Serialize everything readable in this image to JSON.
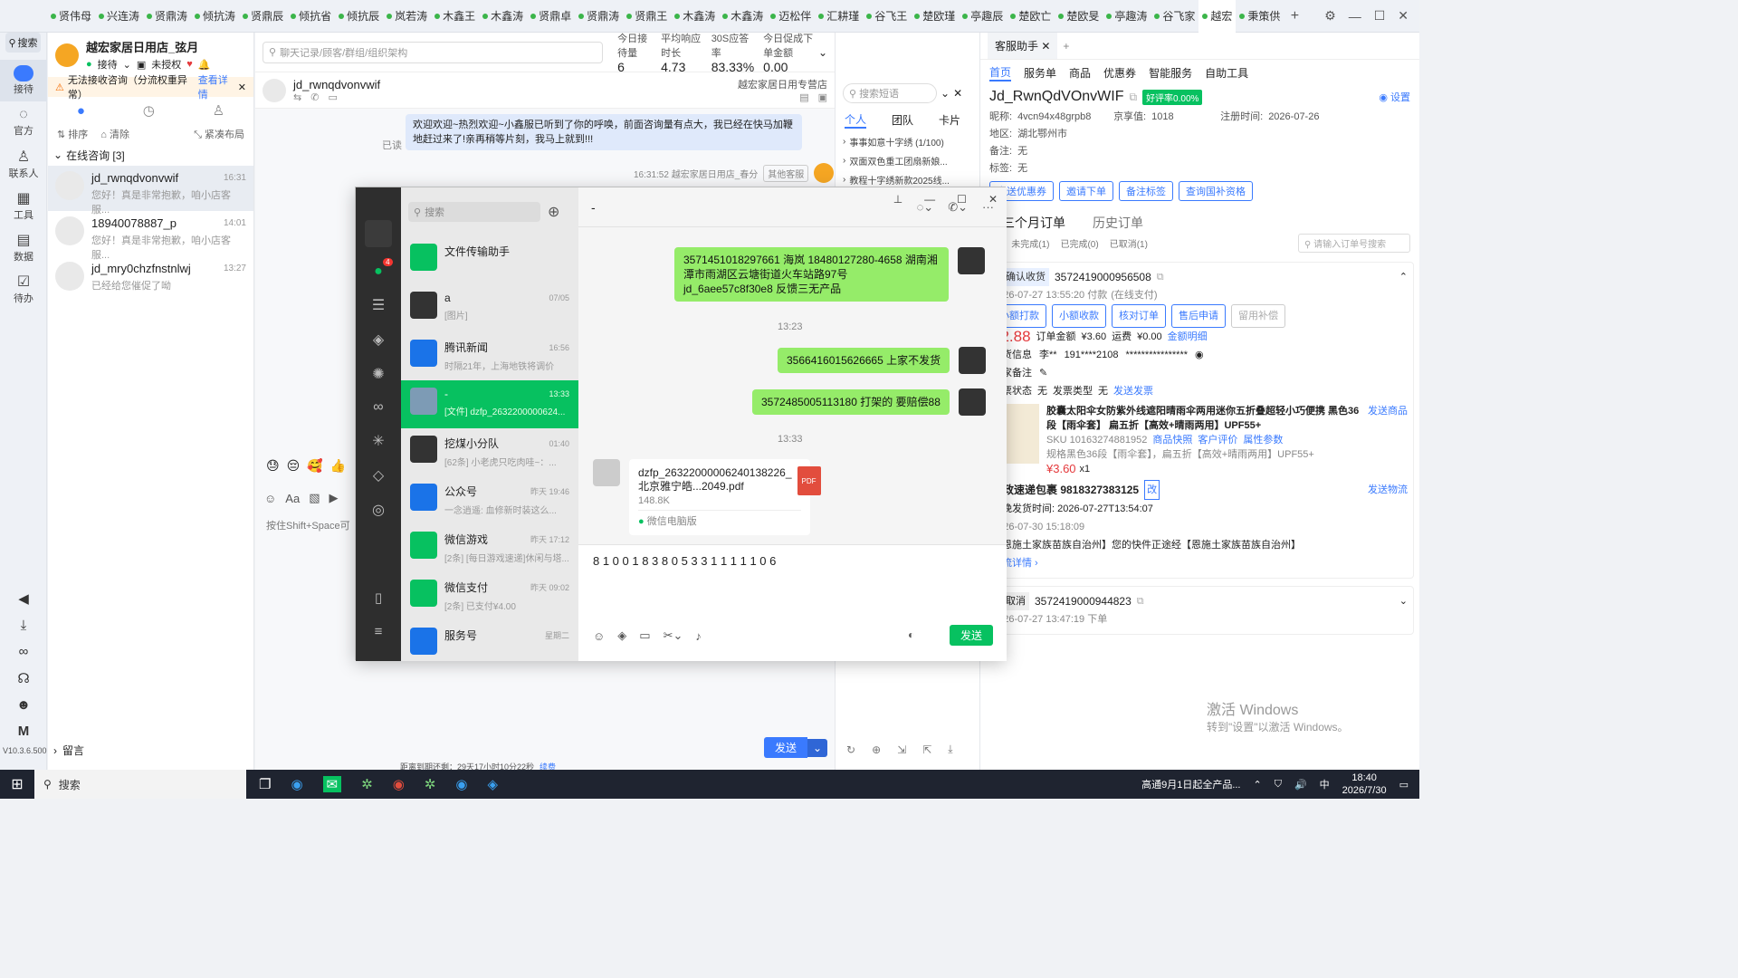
{
  "tabs": [
    "贤伟母",
    "兴连涛",
    "贤鼎涛",
    "倾抗涛",
    "贤鼎辰",
    "倾抗省",
    "倾抗辰",
    "岚若涛",
    "木鑫王",
    "木鑫涛",
    "贤鼎卓",
    "贤鼎涛",
    "贤鼎王",
    "木鑫涛",
    "木鑫涛",
    "迈松伴",
    "汇耕瑾",
    "谷飞王",
    "楚欧瑾",
    "亭趣辰",
    "楚欧亡",
    "楚欧旻",
    "亭趣涛",
    "谷飞家",
    "越宏",
    "秉策供"
  ],
  "rail": {
    "search": "搜索",
    "items": [
      "接待",
      "官方",
      "联系人",
      "工具",
      "数据",
      "待办"
    ],
    "version": "V10.3.6.500"
  },
  "shop": {
    "name": "越宏家居日用店_弦月",
    "status": "接待",
    "auth": "未授权"
  },
  "warning": {
    "text": "无法接收咨询（分流权重异常）",
    "link": "查看详情"
  },
  "contact_tools": {
    "sort": "排序",
    "clear": "清除",
    "layout": "紧凑布局"
  },
  "online_group": "在线咨询 [3]",
  "conversations": [
    {
      "name": "jd_rwnqdvonvwif",
      "time": "16:31",
      "preview": "您好！真是非常抱歉，咱小店客服..."
    },
    {
      "name": "18940078887_p",
      "time": "14:01",
      "preview": "您好！真是非常抱歉，咱小店客服..."
    },
    {
      "name": "jd_mry0chzfnstnlwj",
      "time": "13:27",
      "preview": "已经给您催促了呦"
    }
  ],
  "leave_msg": "留言",
  "chat": {
    "search_placeholder": "聊天记录/顾客/群组/组织架构",
    "stats": [
      {
        "label": "今日接待量",
        "value": "6"
      },
      {
        "label": "平均响应时长",
        "value": "4.73"
      },
      {
        "label": "30S应答率",
        "value": "83.33%"
      },
      {
        "label": "今日促成下单金额",
        "value": "0.00"
      }
    ],
    "customer": "jd_rwnqdvonvwif",
    "shop_tag": "越宏家居日用专营店",
    "welcome": "欢迎欢迎~热烈欢迎~小鑫服已听到了你的呼唤，前面咨询量有点大，我已经在快马加鞭地赶过来了!亲再稍等片刻，我马上就到!!!",
    "read": "已读",
    "meta": "16:31:52  越宏家居日用店_春分",
    "other_cs": "其他客服",
    "hint": "按住Shift+Space可",
    "send": "发送",
    "bottom_note": "距离到期还剩：29天17小时10分22秒",
    "renew": "续费"
  },
  "side": {
    "search_placeholder": "搜索短语",
    "tabs": [
      "个人",
      "团队",
      "卡片"
    ],
    "items": [
      "事事如意十字绣 (1/100)",
      "双面双色重工团扇新娘...",
      "教程十字绣新款2025线..."
    ]
  },
  "right": {
    "tab_title": "客服助手",
    "nav": [
      "首页",
      "服务单",
      "商品",
      "优惠券",
      "智能服务",
      "自助工具"
    ],
    "customer_id": "Jd_RwnQdVOnvWIF",
    "rate": "好评率0.00%",
    "setting": "设置",
    "nick_label": "昵称:",
    "nick": "4vcn94x48grpb8",
    "jd_label": "京享值:",
    "jd": "1018",
    "reg_label": "注册时间:",
    "reg": "2026-07-26",
    "area_label": "地区:",
    "area": "湖北鄂州市",
    "note_label": "备注:",
    "note": "无",
    "tag_label": "标签:",
    "tag": "无",
    "buttons": [
      "发送优惠券",
      "邀请下单",
      "备注标签",
      "查询国补资格"
    ],
    "order_tabs": [
      "近三个月订单",
      "历史订单"
    ],
    "order_filters": [
      "(2)",
      "未完成(1)",
      "已完成(0)",
      "已取消(1)"
    ],
    "order_search": "请输入订单号搜索",
    "order1": {
      "status": "待确认收货",
      "no": "3572419000956508",
      "time": "2026-07-27 13:55:20 付款",
      "pay": "(在线支付)",
      "actions": [
        "小额打款",
        "小额收款",
        "核对订单",
        "售后申请",
        "留用补偿"
      ],
      "price": "¥2.88",
      "total_label": "订单金额",
      "total": "¥3.60",
      "ship_label": "运费",
      "ship": "¥0.00",
      "detail": "金额明细",
      "recv_label": "收货信息",
      "recv": "李**",
      "phone": "191****2108",
      "addr": "****************",
      "remark_label": "商家备注",
      "invoice_label": "发票状态",
      "invoice": "无",
      "invoice_type_label": "发票类型",
      "invoice_type": "无",
      "invoice_send": "发送发票",
      "product": "胶囊太阳伞女防紫外线遮阳晴雨伞两用迷你五折叠超轻小巧便携 黑色36段【雨伞套】 扁五折【高效+晴雨两用】UPF55+",
      "send_product": "发送商品",
      "sku": "SKU 10163274881952",
      "fast": "商品快照",
      "review": "客户评价",
      "attr": "属性参数",
      "spec": "规格黑色36段【雨伞套】，扁五折【高效+晴雨两用】UPF55+",
      "unit_price": "¥3.60",
      "qty": "x1",
      "express": "邮政速递包裹 9818327383125",
      "change": "改",
      "send_express": "发送物流",
      "ship_time": "最晚发货时间:  2026-07-27T13:54:07",
      "track_time": "2026-07-30 15:18:09",
      "track": "【恩施土家族苗族自治州】您的快件正途经【恩施土家族苗族自治州】",
      "track_link": "物流详情"
    },
    "order2": {
      "status": "已取消",
      "no": "3572419000944823",
      "time": "2026-07-27 13:47:19 下单"
    },
    "watermark1": "激活 Windows",
    "watermark2": "转到\"设置\"以激活 Windows。"
  },
  "wechat": {
    "search": "搜索",
    "unread_badge": "4",
    "chats": [
      {
        "name": "文件传输助手",
        "time": "",
        "preview": ""
      },
      {
        "name": "a",
        "time": "07/05",
        "preview": "[图片]"
      },
      {
        "name": "腾讯新闻",
        "time": "16:56",
        "preview": "时隔21年，上海地铁将调价"
      },
      {
        "name": "-",
        "time": "13:33",
        "preview": "[文件] dzfp_2632200000624..."
      },
      {
        "name": "挖煤小分队",
        "time": "01:40",
        "preview": "[62条] 小老虎只吃肉哇~：..."
      },
      {
        "name": "公众号",
        "time": "昨天 19:46",
        "preview": "一念逍遥: 血修新时装这么..."
      },
      {
        "name": "微信游戏",
        "time": "昨天 17:12",
        "preview": "[2条] [每日游戏速递]休闲与塔..."
      },
      {
        "name": "微信支付",
        "time": "昨天 09:02",
        "preview": "[2条] 已支付¥4.00"
      },
      {
        "name": "服务号",
        "time": "星期二",
        "preview": ""
      }
    ],
    "title": "-",
    "messages": [
      {
        "text": "3571451018297661  海岚 18480127280-4658 湖南湘潭市雨湖区云塘街道火车站路97号  jd_6aee57c8f30e8 反馈三无产品"
      },
      {
        "text": "3566416015626665  上家不发货"
      },
      {
        "text": "3572485005113180  打架的 要赔偿88"
      }
    ],
    "time1": "13:23",
    "time2": "13:33",
    "file_name": "dzfp_26322000006240138226_北京雅宁皓...2049.pdf",
    "file_size": "148.8K",
    "file_src": "微信电脑版",
    "pdf": "PDF",
    "input": "8 1 0 0 1 8 3 8 0 5 3 3 1 1 1 1 1 0 6",
    "send": "发送"
  },
  "taskbar": {
    "search": "搜索",
    "notice": "高通9月1日起全产品...",
    "ime": "中",
    "time": "18:40",
    "date": "2026/7/30"
  },
  "colors": {
    "wechat_green": "#07c160",
    "bubble": "#95ec69",
    "brand_blue": "#3a7afe",
    "price_red": "#e4393c"
  }
}
